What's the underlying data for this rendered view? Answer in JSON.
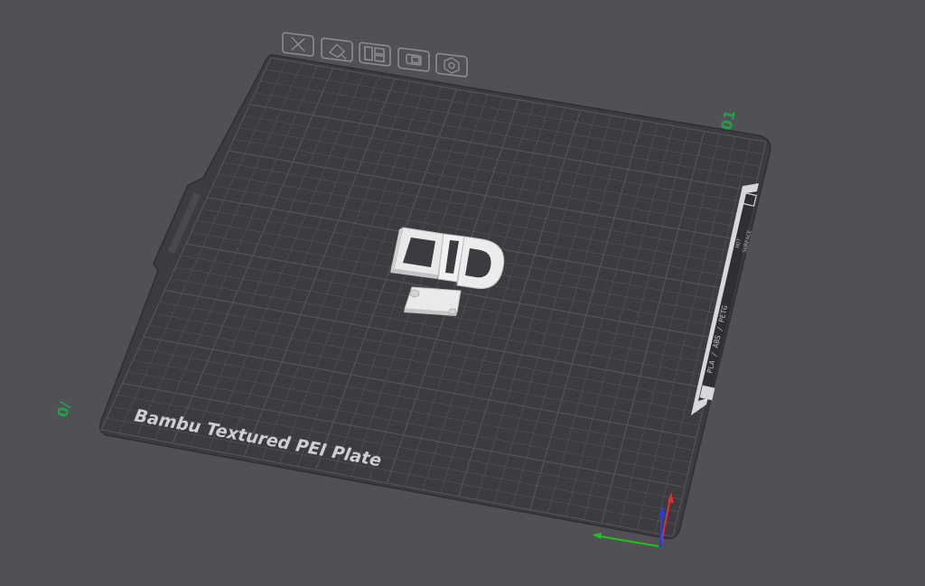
{
  "scene": {
    "background_color": "#505055",
    "plate_color": "#3b3b40",
    "plate_name": "Bambu Textured PEI Plate",
    "plate_number": "01",
    "origin_label": "0/",
    "side_strip_filament_text": "PLA / ABS / PETG",
    "side_strip_hot_text": "HOT",
    "side_strip_surface_text": "SURFACE",
    "grid_color": "#55555b",
    "model_color": "#e6e6e6"
  },
  "plate_toolbar": {
    "buttons": [
      {
        "name": "delete-plate-icon",
        "label": "Remove plate"
      },
      {
        "name": "auto-orient-icon",
        "label": "Auto orient"
      },
      {
        "name": "arrange-icon",
        "label": "Arrange"
      },
      {
        "name": "lock-plate-icon",
        "label": "Lock plate"
      },
      {
        "name": "plate-settings-icon",
        "label": "Plate settings"
      }
    ]
  },
  "axes": {
    "x_color": "#1cc41c",
    "y_color": "#e03030",
    "z_color": "#2040d8"
  }
}
